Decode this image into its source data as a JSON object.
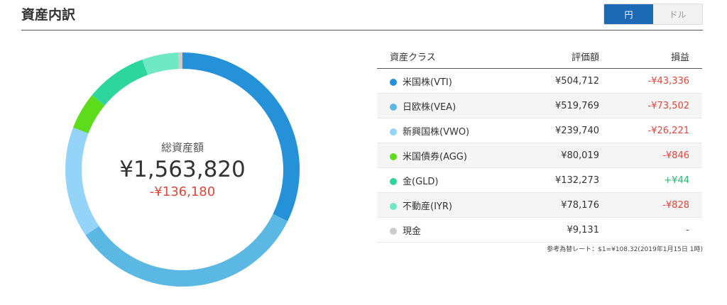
{
  "header": {
    "title": "資産内訳"
  },
  "currency_toggle": [
    {
      "label": "円",
      "active": true
    },
    {
      "label": "ドル",
      "active": false
    }
  ],
  "summary": {
    "label": "総資産額",
    "total": "¥1,563,820",
    "change": "-¥136,180"
  },
  "table": {
    "headers": {
      "class": "資産クラス",
      "value": "評価額",
      "pl": "損益"
    },
    "rows": [
      {
        "name": "米国株(VTI)",
        "value": "¥504,712",
        "value_num": 504712,
        "pl": "-¥43,336",
        "pl_sign": "neg",
        "color": "#2491d8"
      },
      {
        "name": "日欧株(VEA)",
        "value": "¥519,769",
        "value_num": 519769,
        "pl": "-¥73,502",
        "pl_sign": "neg",
        "color": "#5bb8e3"
      },
      {
        "name": "新興国株(VWO)",
        "value": "¥239,740",
        "value_num": 239740,
        "pl": "-¥26,221",
        "pl_sign": "neg",
        "color": "#93d4f8"
      },
      {
        "name": "米国債券(AGG)",
        "value": "¥80,019",
        "value_num": 80019,
        "pl": "-¥846",
        "pl_sign": "neg",
        "color": "#5ddc1c"
      },
      {
        "name": "金(GLD)",
        "value": "¥132,273",
        "value_num": 132273,
        "pl": "+¥44",
        "pl_sign": "pos",
        "color": "#2dd69c"
      },
      {
        "name": "不動産(IYR)",
        "value": "¥78,176",
        "value_num": 78176,
        "pl": "-¥828",
        "pl_sign": "neg",
        "color": "#6fe8c4"
      },
      {
        "name": "現金",
        "value": "¥9,131",
        "value_num": 9131,
        "pl": "-",
        "pl_sign": "flat",
        "color": "#cccccc"
      }
    ]
  },
  "note": "参考為替レート：$1=¥108.32(2019年1月15日 1時)"
}
